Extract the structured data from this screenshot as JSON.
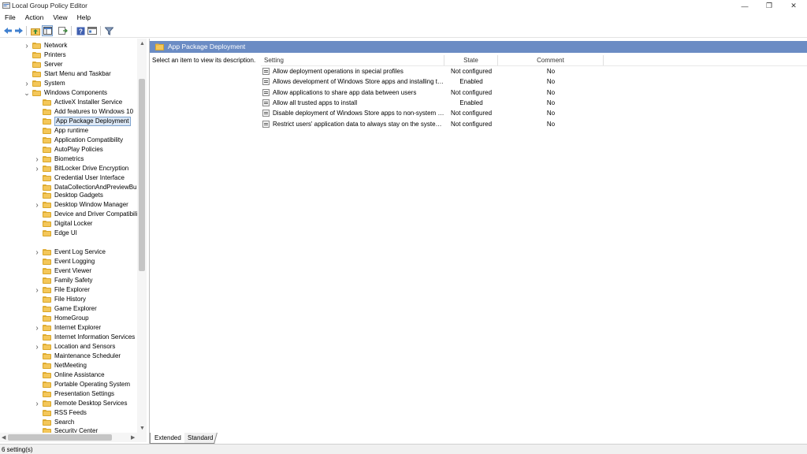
{
  "window": {
    "title": "Local Group Policy Editor",
    "minimize_glyph": "—",
    "restore_glyph": "❐",
    "close_glyph": "✕"
  },
  "menu": [
    "File",
    "Action",
    "View",
    "Help"
  ],
  "toolbar": {
    "icons": [
      "back-arrow-icon",
      "forward-arrow-icon",
      "up-folder-icon",
      "show-hide-tree-icon",
      "export-list-icon",
      "help-icon",
      "properties-icon",
      "filter-icon"
    ]
  },
  "tree": {
    "items": [
      {
        "label": "Network",
        "level": 1,
        "expandable": true
      },
      {
        "label": "Printers",
        "level": 1,
        "expandable": false
      },
      {
        "label": "Server",
        "level": 1,
        "expandable": false
      },
      {
        "label": "Start Menu and Taskbar",
        "level": 1,
        "expandable": false
      },
      {
        "label": "System",
        "level": 1,
        "expandable": true
      },
      {
        "label": "Windows Components",
        "level": 1,
        "expandable": true,
        "expanded": true
      },
      {
        "label": "ActiveX Installer Service",
        "level": 2,
        "expandable": false
      },
      {
        "label": "Add features to Windows 10",
        "level": 2,
        "expandable": false
      },
      {
        "label": "App Package Deployment",
        "level": 2,
        "expandable": false,
        "selected": true
      },
      {
        "label": "App runtime",
        "level": 2,
        "expandable": false
      },
      {
        "label": "Application Compatibility",
        "level": 2,
        "expandable": false
      },
      {
        "label": "AutoPlay Policies",
        "level": 2,
        "expandable": false
      },
      {
        "label": "Biometrics",
        "level": 2,
        "expandable": true
      },
      {
        "label": "BitLocker Drive Encryption",
        "level": 2,
        "expandable": true
      },
      {
        "label": "Credential User Interface",
        "level": 2,
        "expandable": false
      },
      {
        "label": "DataCollectionAndPreviewBuilds",
        "level": 2,
        "expandable": false
      },
      {
        "label": "Desktop Gadgets",
        "level": 2,
        "expandable": false
      },
      {
        "label": "Desktop Window Manager",
        "level": 2,
        "expandable": true
      },
      {
        "label": "Device and Driver Compatibility",
        "level": 2,
        "expandable": false
      },
      {
        "label": "Digital Locker",
        "level": 2,
        "expandable": false
      },
      {
        "label": "Edge UI",
        "level": 2,
        "expandable": false
      },
      {
        "label": "Event Log Service",
        "level": 2,
        "expandable": true
      },
      {
        "label": "Event Logging",
        "level": 2,
        "expandable": false
      },
      {
        "label": "Event Viewer",
        "level": 2,
        "expandable": false
      },
      {
        "label": "Family Safety",
        "level": 2,
        "expandable": false
      },
      {
        "label": "File Explorer",
        "level": 2,
        "expandable": true
      },
      {
        "label": "File History",
        "level": 2,
        "expandable": false
      },
      {
        "label": "Game Explorer",
        "level": 2,
        "expandable": false
      },
      {
        "label": "HomeGroup",
        "level": 2,
        "expandable": false
      },
      {
        "label": "Internet Explorer",
        "level": 2,
        "expandable": true
      },
      {
        "label": "Internet Information Services",
        "level": 2,
        "expandable": false
      },
      {
        "label": "Location and Sensors",
        "level": 2,
        "expandable": true
      },
      {
        "label": "Maintenance Scheduler",
        "level": 2,
        "expandable": false
      },
      {
        "label": "NetMeeting",
        "level": 2,
        "expandable": false
      },
      {
        "label": "Online Assistance",
        "level": 2,
        "expandable": false
      },
      {
        "label": "Portable Operating System",
        "level": 2,
        "expandable": false
      },
      {
        "label": "Presentation Settings",
        "level": 2,
        "expandable": false
      },
      {
        "label": "Remote Desktop Services",
        "level": 2,
        "expandable": true
      },
      {
        "label": "RSS Feeds",
        "level": 2,
        "expandable": false
      },
      {
        "label": "Search",
        "level": 2,
        "expandable": false
      },
      {
        "label": "Security Center",
        "level": 2,
        "expandable": false
      }
    ]
  },
  "details": {
    "header": "App Package Deployment",
    "description": "Select an item to view its description.",
    "columns": {
      "setting": "Setting",
      "state": "State",
      "comment": "Comment"
    },
    "rows": [
      {
        "setting": "Allow deployment operations in special profiles",
        "state": "Not configured",
        "comment": "No"
      },
      {
        "setting": "Allows development of Windows Store apps and installing them from an integrated development environment (IDE)",
        "state": "Enabled",
        "comment": "No"
      },
      {
        "setting": "Allow applications to share app data between users",
        "state": "Not configured",
        "comment": "No"
      },
      {
        "setting": "Allow all trusted apps to install",
        "state": "Enabled",
        "comment": "No"
      },
      {
        "setting": "Disable deployment of Windows Store apps to non-system volumes",
        "state": "Not configured",
        "comment": "No"
      },
      {
        "setting": "Restrict users' application data to always stay on the system volume",
        "state": "Not configured",
        "comment": "No"
      }
    ]
  },
  "tabs": [
    "Extended",
    "Standard"
  ],
  "status": "6 setting(s)",
  "colors": {
    "header_bar": "#6b8cc4",
    "folder": "#f4c75a",
    "selection": "#dce8f6"
  }
}
